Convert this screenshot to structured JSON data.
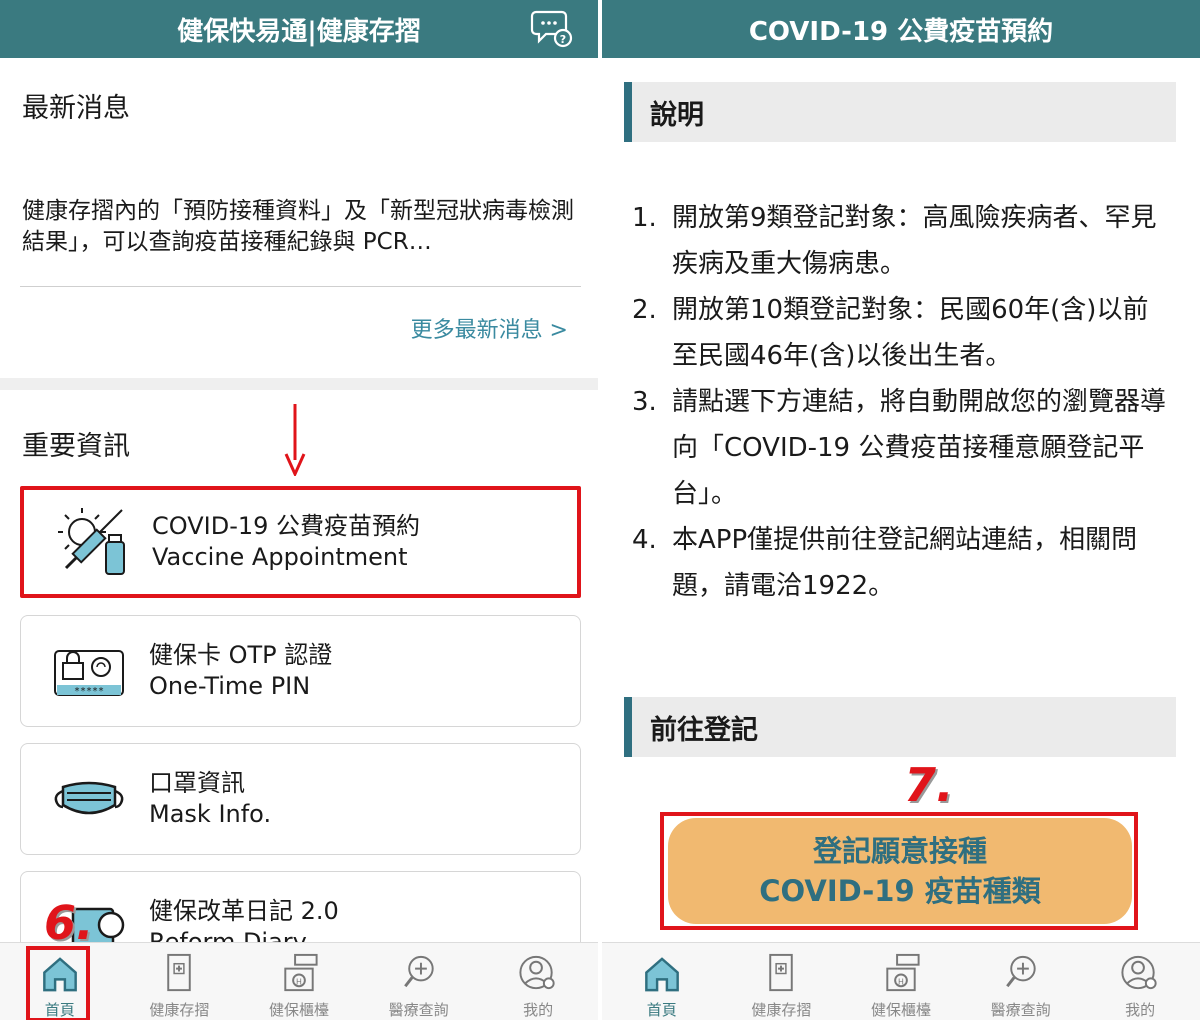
{
  "left": {
    "header_title": "健保快易通|健康存摺",
    "news": {
      "title": "最新消息",
      "text": "健康存摺內的「預防接種資料」及「新型冠狀病毒檢測結果」，可以查詢疫苗接種紀錄與 PCR…",
      "more": "更多最新消息 >"
    },
    "important": {
      "title": "重要資訊",
      "cards": [
        {
          "zh": "COVID-19 公費疫苗預約",
          "en": "Vaccine Appointment"
        },
        {
          "zh": "健保卡 OTP 認證",
          "en": "One-Time PIN"
        },
        {
          "zh": "口罩資訊",
          "en": "Mask Info."
        },
        {
          "zh": "健保改革日記 2.0",
          "en": "Reform Diary"
        }
      ]
    },
    "otp_mask": "*****",
    "step_label": "6."
  },
  "right": {
    "header_title": "COVID-19 公費疫苗預約",
    "desc_title": "說明",
    "items": [
      {
        "num": "1.",
        "text": "開放第9類登記對象：高風險疾病者、罕見疾病及重大傷病患。"
      },
      {
        "num": "2.",
        "text": "開放第10類登記對象：民國60年(含)以前至民國46年(含)以後出生者。"
      },
      {
        "num": "3.",
        "text": "請點選下方連結，將自動開啟您的瀏覽器導向「COVID-19 公費疫苗接種意願登記平台」。"
      },
      {
        "num": "4.",
        "text": "本APP僅提供前往登記網站連結，相關問題，請電洽1922。"
      }
    ],
    "register_title": "前往登記",
    "button_line1": "登記願意接種",
    "button_line2": "COVID-19 疫苗種類",
    "step_label": "7."
  },
  "tabs": [
    {
      "label": "首頁",
      "icon": "home-icon",
      "active": true
    },
    {
      "label": "健康存摺",
      "icon": "health-book-icon",
      "active": false
    },
    {
      "label": "健保櫃檯",
      "icon": "counter-icon",
      "active": false
    },
    {
      "label": "醫療查詢",
      "icon": "medical-search-icon",
      "active": false
    },
    {
      "label": "我的",
      "icon": "profile-icon",
      "active": false
    }
  ],
  "colors": {
    "header": "#3a7a80",
    "highlight": "#e0141a",
    "button": "#f1b970",
    "link": "#3a8aa0"
  }
}
